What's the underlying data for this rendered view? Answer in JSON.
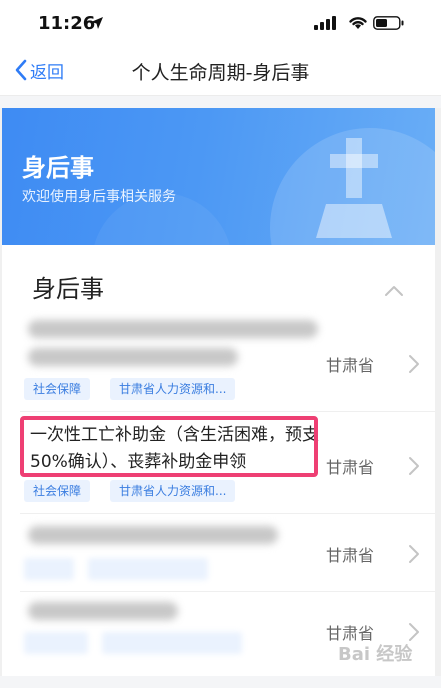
{
  "status": {
    "time": "11:26"
  },
  "nav": {
    "back_label": "返回",
    "title": "个人生命周期-身后事"
  },
  "banner": {
    "title": "身后事",
    "subtitle": "欢迎使用身后事相关服务"
  },
  "section": {
    "title": "身后事"
  },
  "items": [
    {
      "title": "",
      "province": "甘肃省",
      "tags": [
        "社会保障",
        "甘肃省人力资源和..."
      ]
    },
    {
      "title": "一次性工亡补助金（含生活困难，预支50%确认）、丧葬补助金申领",
      "province": "甘肃省",
      "tags": [
        "社会保障",
        "甘肃省人力资源和..."
      ]
    },
    {
      "title": "",
      "province": "甘肃省",
      "tags": []
    },
    {
      "title": "",
      "province": "甘肃省",
      "tags": []
    }
  ],
  "watermark": "Bai 经验",
  "colors": {
    "accent": "#2f7cf6",
    "banner": "#4c98f4",
    "tag_bg": "#eaf2fe",
    "tag_text": "#3a7de0",
    "highlight": "#ee3f73"
  }
}
